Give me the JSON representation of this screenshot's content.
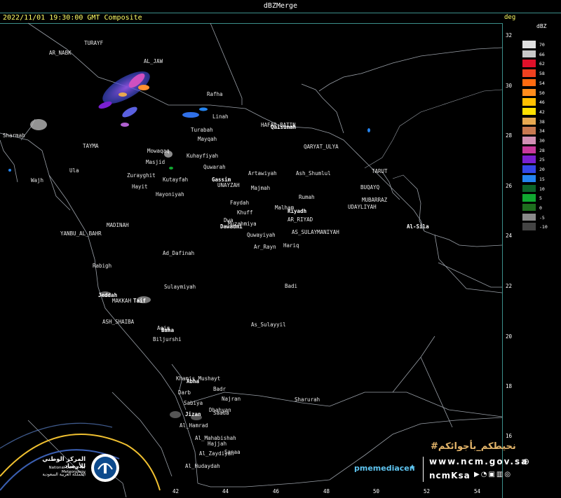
{
  "header": {
    "title": "dBZMerge",
    "subtitle": "2022/11/01 19:30:00 GMT Composite",
    "deg_label": "deg"
  },
  "legend": {
    "unit": "dBZ",
    "entries": [
      {
        "value": "70",
        "color": "#e0e0e0"
      },
      {
        "value": "66",
        "color": "#c8c8c8"
      },
      {
        "value": "62",
        "color": "#e0102a"
      },
      {
        "value": "58",
        "color": "#ef4020"
      },
      {
        "value": "54",
        "color": "#ff6a10"
      },
      {
        "value": "50",
        "color": "#ff8c1c"
      },
      {
        "value": "46",
        "color": "#ffc000"
      },
      {
        "value": "42",
        "color": "#ffe000"
      },
      {
        "value": "38",
        "color": "#e8a850"
      },
      {
        "value": "34",
        "color": "#c87850"
      },
      {
        "value": "30",
        "color": "#d28fb4"
      },
      {
        "value": "28",
        "color": "#c8389c"
      },
      {
        "value": "25",
        "color": "#7a20d0"
      },
      {
        "value": "20",
        "color": "#3548e8"
      },
      {
        "value": "15",
        "color": "#2484f0"
      },
      {
        "value": "10",
        "color": "#0c6428"
      },
      {
        "value": "5",
        "color": "#10a830"
      },
      {
        "value": "0",
        "color": "#1e6e1e"
      },
      {
        "value": "-5",
        "color": "#8a8a8a"
      },
      {
        "value": "-10",
        "color": "#444444"
      }
    ]
  },
  "axes": {
    "lat_ticks": [
      "32",
      "30",
      "28",
      "26",
      "24",
      "22",
      "20",
      "18",
      "16"
    ],
    "lon_ticks": [
      "42",
      "44",
      "46",
      "48",
      "50",
      "52",
      "54"
    ]
  },
  "places": [
    {
      "name": "TURAYF",
      "bold": false
    },
    {
      "name": "AR_NABK",
      "bold": false
    },
    {
      "name": "AL_JAW",
      "bold": false
    },
    {
      "name": "Rafha",
      "bold": false
    },
    {
      "name": "Linah",
      "bold": false
    },
    {
      "name": "Turabah",
      "bold": false
    },
    {
      "name": "Mayqah",
      "bold": false
    },
    {
      "name": "HAFAR_BATIN",
      "bold": false
    },
    {
      "name": "Qaisumah",
      "bold": true
    },
    {
      "name": "QARYAT_ULYA",
      "bold": false
    },
    {
      "name": "Sharmah",
      "bold": false
    },
    {
      "name": "TAYMA",
      "bold": false
    },
    {
      "name": "Mowaqaq",
      "bold": false
    },
    {
      "name": "Masjid",
      "bold": false
    },
    {
      "name": "Kuhayfiyah",
      "bold": false
    },
    {
      "name": "Quwarah",
      "bold": false
    },
    {
      "name": "Ula",
      "bold": false
    },
    {
      "name": "Zurayghit",
      "bold": false
    },
    {
      "name": "Kutayfah",
      "bold": false
    },
    {
      "name": "Gassim",
      "bold": true
    },
    {
      "name": "UNAYZAH",
      "bold": false
    },
    {
      "name": "Artawiyah",
      "bold": false
    },
    {
      "name": "Ash_Shumlul",
      "bold": false
    },
    {
      "name": "TARUT",
      "bold": false
    },
    {
      "name": "Wajh",
      "bold": false
    },
    {
      "name": "Hayit",
      "bold": false
    },
    {
      "name": "Hayoniyah",
      "bold": false
    },
    {
      "name": "Majmah",
      "bold": false
    },
    {
      "name": "Rumah",
      "bold": false
    },
    {
      "name": "BUQAYQ",
      "bold": false
    },
    {
      "name": "MUBARRAZ",
      "bold": false
    },
    {
      "name": "UDAYLIYAH",
      "bold": false
    },
    {
      "name": "Faydah",
      "bold": false
    },
    {
      "name": "Malham",
      "bold": false
    },
    {
      "name": "Riyadh",
      "bold": true
    },
    {
      "name": "Khuff",
      "bold": false
    },
    {
      "name": "Dwa",
      "bold": false
    },
    {
      "name": "AR_RIYAD",
      "bold": false
    },
    {
      "name": "MADINAH",
      "bold": false
    },
    {
      "name": "Muzahmiya",
      "bold": false
    },
    {
      "name": "Dawadmi",
      "bold": true
    },
    {
      "name": "YANBU_AL_BAHR",
      "bold": false
    },
    {
      "name": "AS_SULAYMANIYAH",
      "bold": false
    },
    {
      "name": "Al-Sila",
      "bold": true
    },
    {
      "name": "Quwayiyah",
      "bold": false
    },
    {
      "name": "Ar_Rayn",
      "bold": false
    },
    {
      "name": "Hariq",
      "bold": false
    },
    {
      "name": "Ad_Dafinah",
      "bold": false
    },
    {
      "name": "Rabigh",
      "bold": false
    },
    {
      "name": "Sulaymiyah",
      "bold": false
    },
    {
      "name": "Badi",
      "bold": false
    },
    {
      "name": "Jeddah",
      "bold": true
    },
    {
      "name": "MAKKAH",
      "bold": false
    },
    {
      "name": "Taif",
      "bold": true
    },
    {
      "name": "ASH_SHAIBA",
      "bold": false
    },
    {
      "name": "As_Sulayyil",
      "bold": false
    },
    {
      "name": "Aqiq",
      "bold": false
    },
    {
      "name": "Baha",
      "bold": true
    },
    {
      "name": "Biljurshi",
      "bold": false
    },
    {
      "name": "Khamis_Mushayt",
      "bold": false
    },
    {
      "name": "Abha",
      "bold": true
    },
    {
      "name": "Badr",
      "bold": false
    },
    {
      "name": "Najran",
      "bold": false
    },
    {
      "name": "Sharurah",
      "bold": false
    },
    {
      "name": "Darb",
      "bold": false
    },
    {
      "name": "Sabiya",
      "bold": false
    },
    {
      "name": "Jizan",
      "bold": true
    },
    {
      "name": "Dhahyan",
      "bold": false
    },
    {
      "name": "Saada",
      "bold": false
    },
    {
      "name": "Al_Hamrad",
      "bold": false
    },
    {
      "name": "Al_Mahabishah",
      "bold": false
    },
    {
      "name": "Hajjah",
      "bold": false
    },
    {
      "name": "Al_Zaydiyah",
      "bold": false
    },
    {
      "name": "Sanaa",
      "bold": false
    },
    {
      "name": "Al_Hudaydah",
      "bold": false
    }
  ],
  "branding": {
    "hashtag": "#نحيطكم_بأجوائكم",
    "website": "www.ncm.gov.sa",
    "handle": "ncmKsa",
    "twitter_handle": "pmemediacen",
    "org_name_ar": "المركز الوطني للأرصاد",
    "org_name_en": "National Center for Meteorology",
    "country_ar": "المملكة العربية السعودية"
  }
}
